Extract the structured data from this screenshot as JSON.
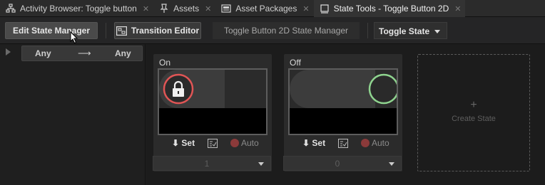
{
  "tabs": [
    {
      "label": "Activity Browser: Toggle button",
      "icon": "hierarchy-icon"
    },
    {
      "label": "Assets",
      "icon": "pin-icon"
    },
    {
      "label": "Asset Packages",
      "icon": "package-icon"
    },
    {
      "label": "State Tools - Toggle Button 2D",
      "icon": "window-icon",
      "active": true
    }
  ],
  "toolbar": {
    "edit_state_manager": "Edit State Manager",
    "transition_editor": "Transition Editor",
    "state_manager_name": "Toggle Button 2D State Manager",
    "state_group": "Toggle State"
  },
  "transitions": {
    "from": "Any",
    "to": "Any"
  },
  "states": [
    {
      "title": "On",
      "set_label": "Set",
      "auto_label": "Auto",
      "value": "1"
    },
    {
      "title": "Off",
      "set_label": "Set",
      "auto_label": "Auto",
      "value": "0"
    }
  ],
  "create_state": {
    "plus": "+",
    "label": "Create State"
  },
  "colors": {
    "on_ring": "#e05555",
    "off_ring": "#8fd48f",
    "auto_dot": "#8b3a3a"
  }
}
